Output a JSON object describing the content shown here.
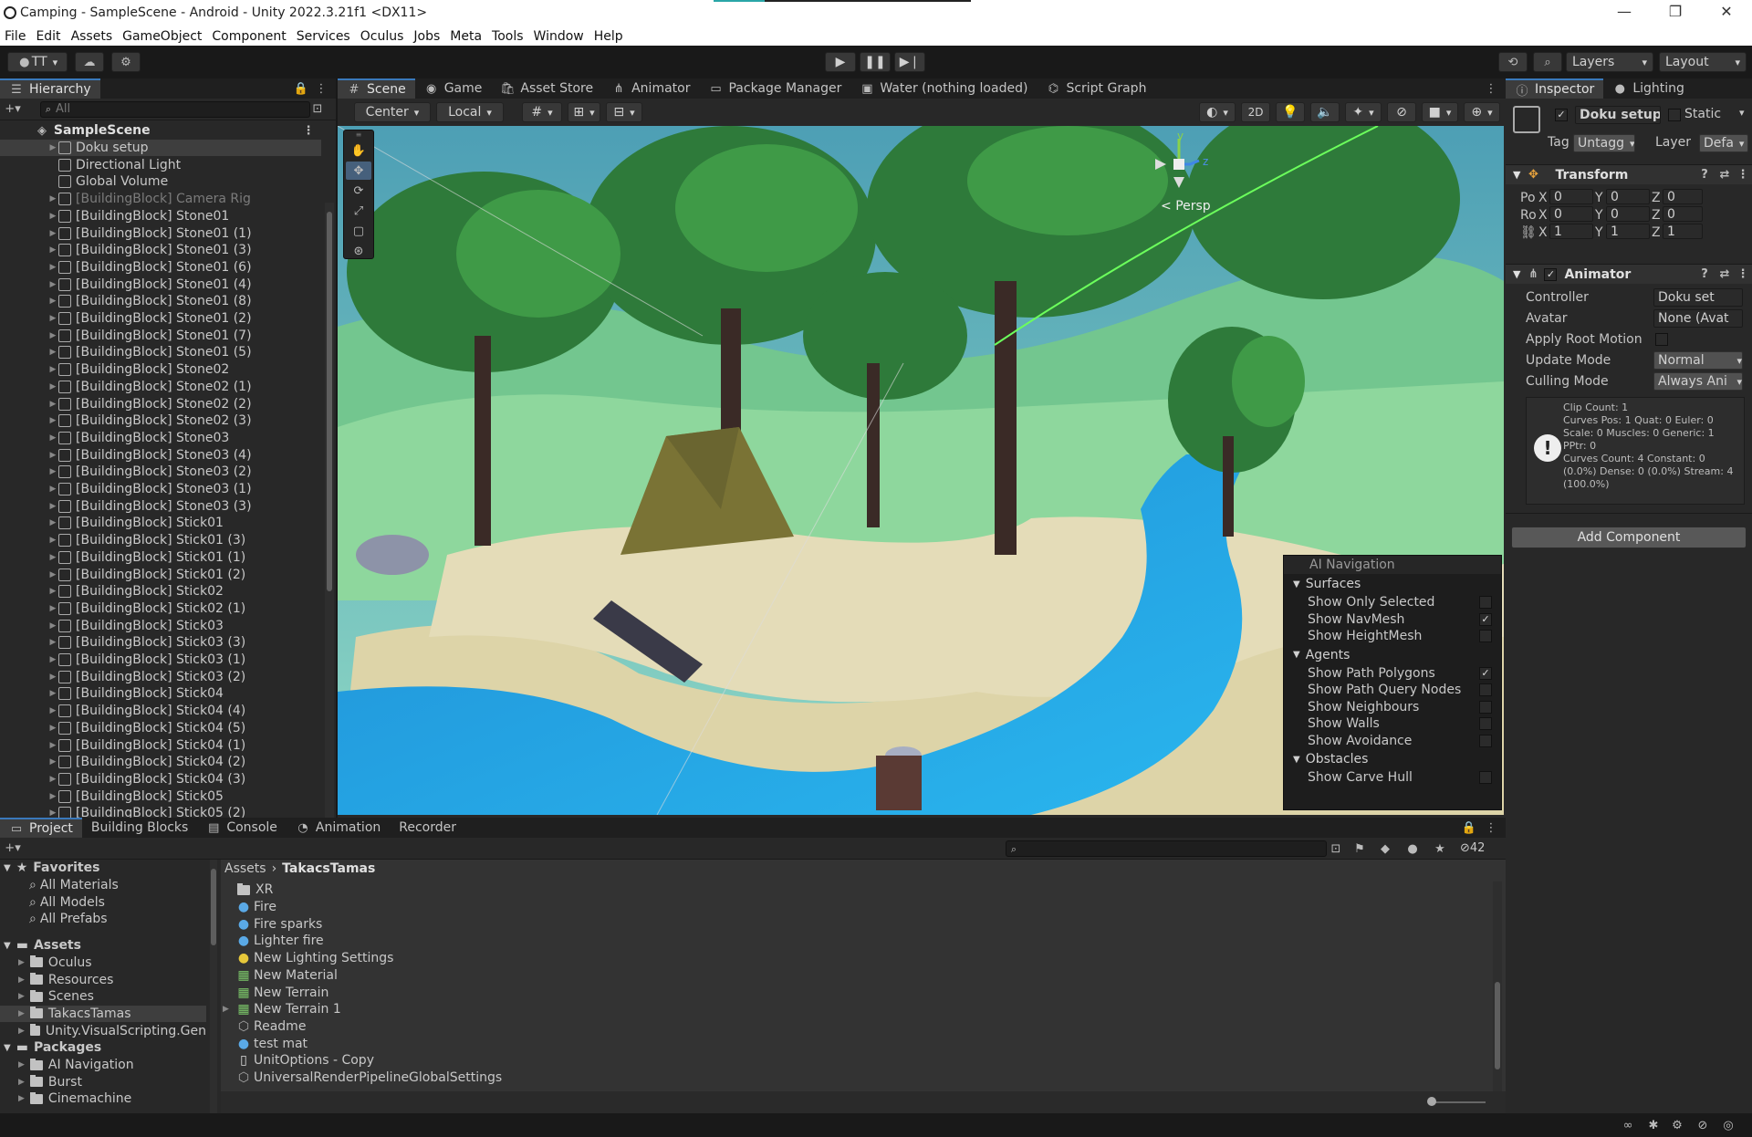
{
  "window": {
    "title": "Camping - SampleScene - Android - Unity 2022.3.21f1 <DX11>",
    "controls": [
      "—",
      "❐",
      "✕"
    ]
  },
  "menu": [
    "File",
    "Edit",
    "Assets",
    "GameObject",
    "Component",
    "Services",
    "Oculus",
    "Jobs",
    "Meta",
    "Tools",
    "Window",
    "Help"
  ],
  "toolbar": {
    "account": "TT",
    "layers": "Layers",
    "layout": "Layout"
  },
  "hierarchy": {
    "tab": "Hierarchy",
    "search_placeholder": "All",
    "scene": "SampleScene",
    "items": [
      {
        "label": "Doku setup",
        "dim": false,
        "sel": true
      },
      {
        "label": "Directional Light",
        "dim": false,
        "sel": false
      },
      {
        "label": "Global Volume",
        "dim": false,
        "sel": false
      },
      {
        "label": "[BuildingBlock] Camera Rig",
        "dim": true,
        "sel": false
      },
      {
        "label": "[BuildingBlock] Stone01",
        "dim": false,
        "sel": false
      },
      {
        "label": "[BuildingBlock] Stone01 (1)",
        "dim": false,
        "sel": false
      },
      {
        "label": "[BuildingBlock] Stone01 (3)",
        "dim": false,
        "sel": false
      },
      {
        "label": "[BuildingBlock] Stone01 (6)",
        "dim": false,
        "sel": false
      },
      {
        "label": "[BuildingBlock] Stone01 (4)",
        "dim": false,
        "sel": false
      },
      {
        "label": "[BuildingBlock] Stone01 (8)",
        "dim": false,
        "sel": false
      },
      {
        "label": "[BuildingBlock] Stone01 (2)",
        "dim": false,
        "sel": false
      },
      {
        "label": "[BuildingBlock] Stone01 (7)",
        "dim": false,
        "sel": false
      },
      {
        "label": "[BuildingBlock] Stone01 (5)",
        "dim": false,
        "sel": false
      },
      {
        "label": "[BuildingBlock] Stone02",
        "dim": false,
        "sel": false
      },
      {
        "label": "[BuildingBlock] Stone02 (1)",
        "dim": false,
        "sel": false
      },
      {
        "label": "[BuildingBlock] Stone02 (2)",
        "dim": false,
        "sel": false
      },
      {
        "label": "[BuildingBlock] Stone02 (3)",
        "dim": false,
        "sel": false
      },
      {
        "label": "[BuildingBlock] Stone03",
        "dim": false,
        "sel": false
      },
      {
        "label": "[BuildingBlock] Stone03 (4)",
        "dim": false,
        "sel": false
      },
      {
        "label": "[BuildingBlock] Stone03 (2)",
        "dim": false,
        "sel": false
      },
      {
        "label": "[BuildingBlock] Stone03 (1)",
        "dim": false,
        "sel": false
      },
      {
        "label": "[BuildingBlock] Stone03 (3)",
        "dim": false,
        "sel": false
      },
      {
        "label": "[BuildingBlock] Stick01",
        "dim": false,
        "sel": false
      },
      {
        "label": "[BuildingBlock] Stick01 (3)",
        "dim": false,
        "sel": false
      },
      {
        "label": "[BuildingBlock] Stick01 (1)",
        "dim": false,
        "sel": false
      },
      {
        "label": "[BuildingBlock] Stick01 (2)",
        "dim": false,
        "sel": false
      },
      {
        "label": "[BuildingBlock] Stick02",
        "dim": false,
        "sel": false
      },
      {
        "label": "[BuildingBlock] Stick02 (1)",
        "dim": false,
        "sel": false
      },
      {
        "label": "[BuildingBlock] Stick03",
        "dim": false,
        "sel": false
      },
      {
        "label": "[BuildingBlock] Stick03 (3)",
        "dim": false,
        "sel": false
      },
      {
        "label": "[BuildingBlock] Stick03 (1)",
        "dim": false,
        "sel": false
      },
      {
        "label": "[BuildingBlock] Stick03 (2)",
        "dim": false,
        "sel": false
      },
      {
        "label": "[BuildingBlock] Stick04",
        "dim": false,
        "sel": false
      },
      {
        "label": "[BuildingBlock] Stick04 (4)",
        "dim": false,
        "sel": false
      },
      {
        "label": "[BuildingBlock] Stick04 (5)",
        "dim": false,
        "sel": false
      },
      {
        "label": "[BuildingBlock] Stick04 (1)",
        "dim": false,
        "sel": false
      },
      {
        "label": "[BuildingBlock] Stick04 (2)",
        "dim": false,
        "sel": false
      },
      {
        "label": "[BuildingBlock] Stick04 (3)",
        "dim": false,
        "sel": false
      },
      {
        "label": "[BuildingBlock] Stick05",
        "dim": false,
        "sel": false
      },
      {
        "label": "[BuildingBlock] Stick05 (2)",
        "dim": false,
        "sel": false
      }
    ]
  },
  "scene_tabs": [
    "Scene",
    "Game",
    "Asset Store",
    "Animator",
    "Package Manager",
    "Water (nothing loaded)",
    "Script Graph"
  ],
  "scene_toolbar": {
    "pivot": "Center",
    "space": "Local",
    "mode2d": "2D",
    "persp": "Persp",
    "gizmo_y": "y",
    "gizmo_z": "z"
  },
  "ai_nav": {
    "title": "AI Navigation",
    "groups": [
      {
        "name": "Surfaces",
        "items": [
          {
            "label": "Show Only Selected",
            "checked": false
          },
          {
            "label": "Show NavMesh",
            "checked": true
          },
          {
            "label": "Show HeightMesh",
            "checked": false
          }
        ]
      },
      {
        "name": "Agents",
        "items": [
          {
            "label": "Show Path Polygons",
            "checked": true
          },
          {
            "label": "Show Path Query Nodes",
            "checked": false
          },
          {
            "label": "Show Neighbours",
            "checked": false
          },
          {
            "label": "Show Walls",
            "checked": false
          },
          {
            "label": "Show Avoidance",
            "checked": false
          }
        ]
      },
      {
        "name": "Obstacles",
        "items": [
          {
            "label": "Show Carve Hull",
            "checked": false
          }
        ]
      }
    ]
  },
  "inspector": {
    "tabs": [
      "Inspector",
      "Lighting"
    ],
    "object_name": "Doku setup",
    "static_label": "Static",
    "tag_label": "Tag",
    "tag_value": "Untagg",
    "layer_label": "Layer",
    "layer_value": "Defa",
    "transform": {
      "title": "Transform",
      "rows": [
        {
          "label": "Po",
          "x": "0",
          "y": "0",
          "z": "0"
        },
        {
          "label": "Ro",
          "x": "0",
          "y": "0",
          "z": "0"
        },
        {
          "label": "",
          "x": "1",
          "y": "1",
          "z": "1"
        }
      ]
    },
    "animator": {
      "title": "Animator",
      "controller_label": "Controller",
      "controller_value": "Doku set",
      "avatar_label": "Avatar",
      "avatar_value": "None (Avat",
      "apply_root_label": "Apply Root Motion",
      "update_label": "Update Mode",
      "update_value": "Normal",
      "culling_label": "Culling Mode",
      "culling_value": "Always Ani",
      "info": [
        "Clip Count: 1",
        "Curves Pos: 1 Quat: 0 Euler: 0",
        "Scale: 0 Muscles: 0 Generic: 1",
        "PPtr: 0",
        "Curves Count: 4 Constant: 0",
        "(0.0%) Dense: 0 (0.0%) Stream: 4",
        "(100.0%)"
      ]
    },
    "add_component": "Add Component"
  },
  "project": {
    "tabs": [
      "Project",
      "Building Blocks",
      "Console",
      "Animation",
      "Recorder"
    ],
    "count": "42",
    "favorites_label": "Favorites",
    "favorites": [
      "All Materials",
      "All Models",
      "All Prefabs"
    ],
    "assets_label": "Assets",
    "asset_folders": [
      "Oculus",
      "Resources",
      "Scenes",
      "TakacsTamas",
      "Unity.VisualScripting.Gen"
    ],
    "packages_label": "Packages",
    "package_folders": [
      "AI Navigation",
      "Burst",
      "Cinemachine"
    ],
    "breadcrumb": [
      "Assets",
      "TakacsTamas"
    ],
    "files": [
      {
        "name": "XR",
        "kind": "folder"
      },
      {
        "name": "Fire",
        "kind": "vfx"
      },
      {
        "name": "Fire sparks",
        "kind": "vfx"
      },
      {
        "name": "Lighter fire",
        "kind": "vfx"
      },
      {
        "name": "New Lighting Settings",
        "kind": "light"
      },
      {
        "name": "New Material",
        "kind": "mat"
      },
      {
        "name": "New Terrain",
        "kind": "terrain"
      },
      {
        "name": "New Terrain 1",
        "kind": "terrain"
      },
      {
        "name": "Readme",
        "kind": "cube"
      },
      {
        "name": "test mat",
        "kind": "vfx"
      },
      {
        "name": "UnitOptions - Copy",
        "kind": "doc"
      },
      {
        "name": "UniversalRenderPipelineGlobalSettings",
        "kind": "cube"
      }
    ]
  },
  "colors": {
    "accent": "#3a79bb",
    "panel": "#282828",
    "toolbar": "#191919"
  }
}
